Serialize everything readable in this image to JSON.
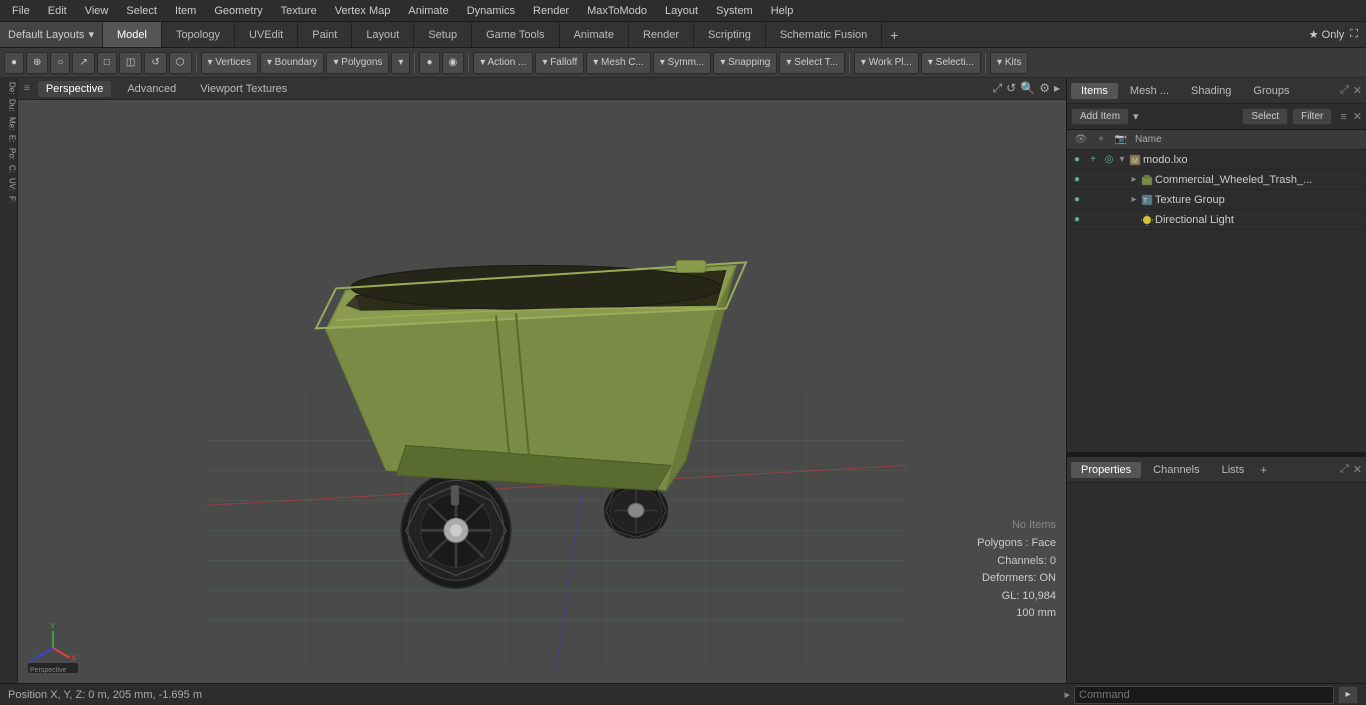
{
  "menubar": {
    "items": [
      "File",
      "Edit",
      "View",
      "Select",
      "Item",
      "Geometry",
      "Texture",
      "Vertex Map",
      "Animate",
      "Dynamics",
      "Render",
      "MaxToModo",
      "Layout",
      "System",
      "Help"
    ]
  },
  "layout": {
    "selector": "Default Layouts",
    "tabs": [
      "Model",
      "Topology",
      "UVEdit",
      "Paint",
      "Layout",
      "Setup",
      "Game Tools",
      "Animate",
      "Render",
      "Scripting",
      "Schematic Fusion"
    ],
    "active_tab": "Model",
    "add_icon": "+",
    "right": {
      "star": "★ Only"
    }
  },
  "toolbar": {
    "items": [
      {
        "label": "•",
        "type": "dot"
      },
      {
        "label": "⊕"
      },
      {
        "label": "○"
      },
      {
        "label": "↗"
      },
      {
        "label": "□"
      },
      {
        "label": "◫"
      },
      {
        "label": "◷"
      },
      {
        "label": "⬡"
      },
      {
        "label": "sep"
      },
      {
        "label": "▾ Vertices"
      },
      {
        "label": "▾ Boundary"
      },
      {
        "label": "▾ Polygons"
      },
      {
        "label": "▾"
      },
      {
        "label": "sep"
      },
      {
        "label": "●"
      },
      {
        "label": "◉"
      },
      {
        "label": "sep"
      },
      {
        "label": "▾ Action ..."
      },
      {
        "label": "▾ Falloff"
      },
      {
        "label": "▾ Mesh C..."
      },
      {
        "label": "▾ Symm..."
      },
      {
        "label": "▾ Snapping"
      },
      {
        "label": "▾ Select T..."
      },
      {
        "label": "sep"
      },
      {
        "label": "▾ Work Pl..."
      },
      {
        "label": "▾ Selecti..."
      },
      {
        "label": "sep"
      },
      {
        "label": "▾ Kits"
      }
    ]
  },
  "viewport": {
    "tabs": [
      "Perspective",
      "Advanced",
      "Viewport Textures"
    ],
    "active_tab": "Perspective",
    "status": {
      "no_items": "No Items",
      "polygons": "Polygons : Face",
      "channels": "Channels: 0",
      "deformers": "Deformers: ON",
      "gl": "GL: 10,984",
      "size": "100 mm"
    }
  },
  "left_toolbar": {
    "items": [
      "De:",
      "Du:",
      "Me:",
      "E:",
      "Po:",
      "C:",
      "UV:",
      "F:"
    ]
  },
  "right_panel": {
    "tabs": [
      "Items",
      "Mesh ...",
      "Shading",
      "Groups"
    ],
    "active_tab": "Items",
    "toolbar": {
      "add_item": "Add Item",
      "dropdown": "▾",
      "select": "Select",
      "filter": "Filter"
    },
    "list_header": {
      "name": "Name"
    },
    "items": [
      {
        "id": 1,
        "level": 0,
        "expand": "▾",
        "icon": "mesh",
        "label": "modo.lxo",
        "vis": true
      },
      {
        "id": 2,
        "level": 1,
        "expand": "▸",
        "icon": "mesh",
        "label": "Commercial_Wheeled_Trash_...",
        "vis": true
      },
      {
        "id": 3,
        "level": 1,
        "expand": "▸",
        "icon": "texture",
        "label": "Texture Group",
        "vis": true
      },
      {
        "id": 4,
        "level": 1,
        "expand": " ",
        "icon": "light",
        "label": "Directional Light",
        "vis": true
      }
    ]
  },
  "properties": {
    "tabs": [
      "Properties",
      "Channels",
      "Lists"
    ],
    "active_tab": "Properties",
    "add_icon": "+"
  },
  "bottom_bar": {
    "position": "Position X, Y, Z:  0 m, 205 mm, -1.695 m",
    "command_placeholder": "Command",
    "arrow": "▸"
  }
}
